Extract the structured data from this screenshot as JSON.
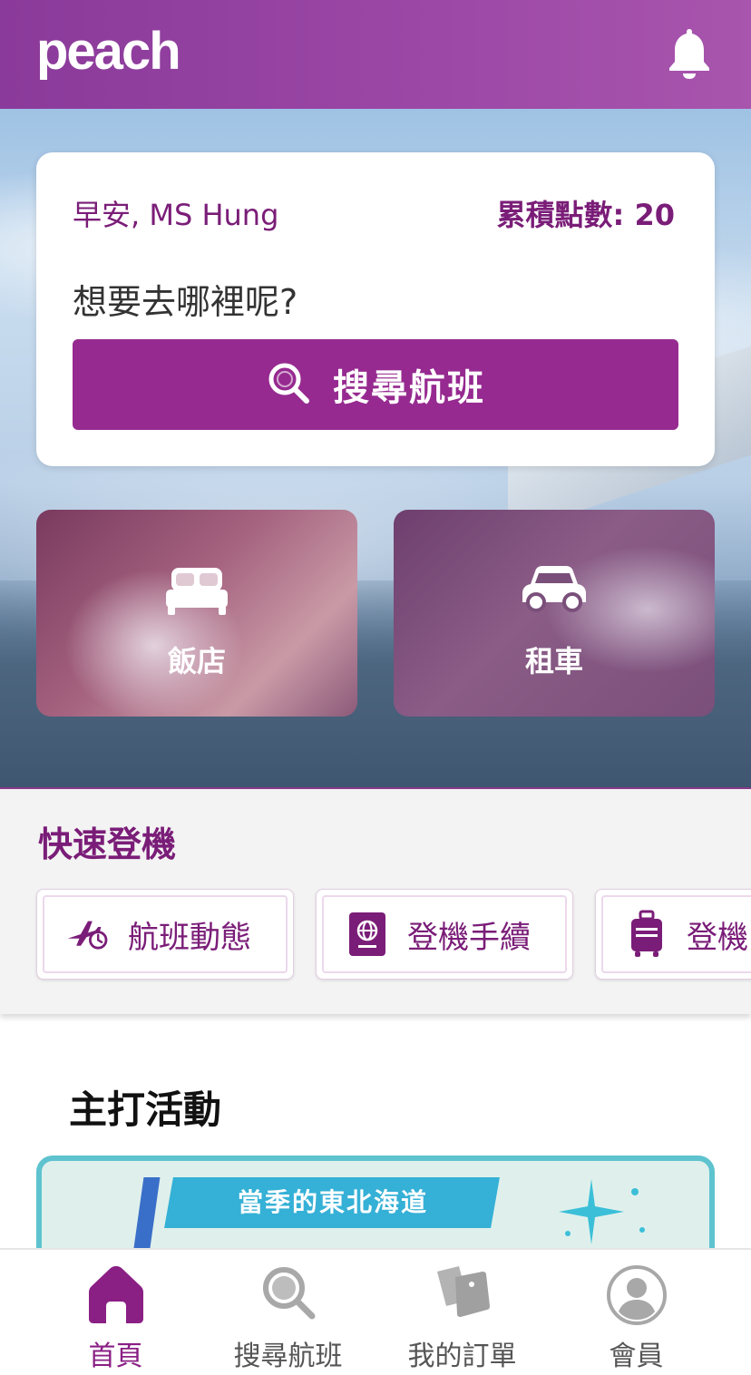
{
  "header": {
    "logo_text": "peach",
    "bell_icon": "bell-icon"
  },
  "account": {
    "greeting": "早安, MS Hung",
    "points": "累積點數: 20"
  },
  "search_card": {
    "question": "想要去哪裡呢?",
    "search_label": "搜尋航班",
    "search_icon": "search-icon"
  },
  "tiles": [
    {
      "label": "飯店",
      "icon": "bed-icon"
    },
    {
      "label": "租車",
      "icon": "car-icon"
    }
  ],
  "quick": {
    "title": "快速登機",
    "items": [
      {
        "label": "航班動態",
        "icon": "flight-status-icon"
      },
      {
        "label": "登機手續",
        "icon": "passport-icon"
      },
      {
        "label": "登機",
        "icon": "luggage-icon"
      }
    ]
  },
  "featured": {
    "title": "主打活動",
    "banner_text": "當季的東北海道"
  },
  "tabbar": {
    "tabs": [
      {
        "label": "首頁",
        "icon": "home-icon",
        "active": true
      },
      {
        "label": "搜尋航班",
        "icon": "search-icon",
        "active": false
      },
      {
        "label": "我的訂單",
        "icon": "tickets-icon",
        "active": false
      },
      {
        "label": "會員",
        "icon": "profile-icon",
        "active": false
      }
    ]
  },
  "colors": {
    "brand": "#962a90",
    "brand_text": "#7a1d78",
    "header": "#9b47a6",
    "banner_border": "#5ec3cf"
  }
}
